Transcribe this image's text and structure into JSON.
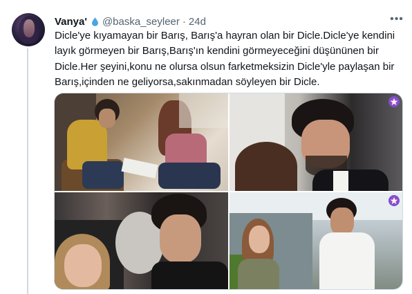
{
  "tweet": {
    "display_name": "Vanya'",
    "verified_emoji_icon": "water-drop-icon",
    "handle": "@baska_seyleer",
    "separator": "·",
    "time": "24d",
    "more_icon": "ellipsis-icon",
    "more_label": "•••",
    "text": "Dicle'ye kıyamayan bir Barış, Barış'a hayran olan bir Dicle.Dicle'ye kendini layık görmeyen bir Barış,Barış'ın kendini görmeyeceğini düşününen bir Dicle.Her şeyini,konu ne olursa olsun farketmeksizin Dicle'yle paylaşan bir Barış,içinden ne geliyorsa,sakınmadan söyleyen bir Dicle.",
    "media_count": 4,
    "channel_logo_icon": "star-logo-icon",
    "channel_logo_glyph": "★"
  },
  "colors": {
    "text_primary": "#0f1419",
    "text_secondary": "#536471",
    "border": "#cfd9de",
    "drop_blue": "#4aa5e0"
  }
}
